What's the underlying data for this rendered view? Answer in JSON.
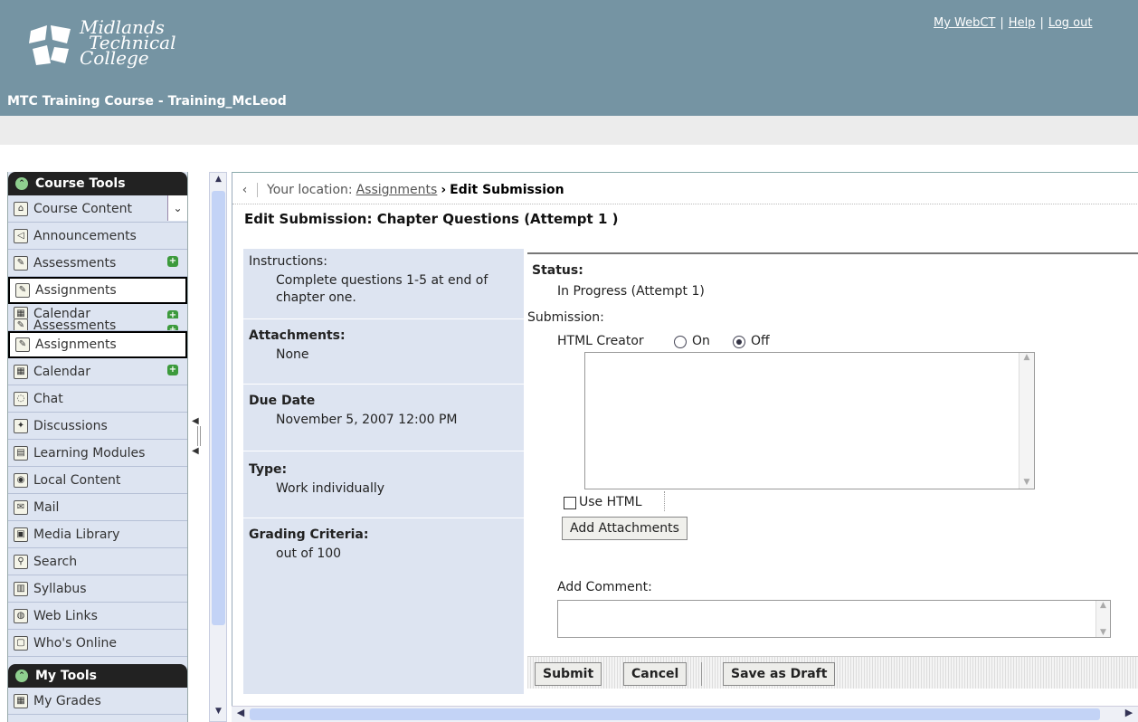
{
  "header": {
    "logo_line1": "Midlands",
    "logo_line2": "Technical",
    "logo_line3": "College",
    "course_title": "MTC Training Course - Training_McLeod",
    "links": {
      "my_webct": "My WebCT",
      "help": "Help",
      "logout": "Log out",
      "separator": "|"
    }
  },
  "sidebar": {
    "course_tools_label": "Course Tools",
    "my_tools_label": "My Tools",
    "items": [
      {
        "label": "Course Content",
        "icon": "home-icon"
      },
      {
        "label": "Announcements",
        "icon": "megaphone-icon"
      },
      {
        "label": "Assessments",
        "icon": "assessment-icon"
      },
      {
        "label": "Assignments",
        "icon": "assignment-icon"
      },
      {
        "label": "Calendar",
        "icon": "calendar-icon"
      },
      {
        "label": "Assessments",
        "icon": "assessment-icon"
      },
      {
        "label": "Assignments",
        "icon": "assignment-icon"
      },
      {
        "label": "Calendar",
        "icon": "calendar-icon"
      },
      {
        "label": "Chat",
        "icon": "chat-icon"
      },
      {
        "label": "Discussions",
        "icon": "pin-icon"
      },
      {
        "label": "Learning Modules",
        "icon": "module-icon"
      },
      {
        "label": "Local Content",
        "icon": "disc-icon"
      },
      {
        "label": "Mail",
        "icon": "mail-icon"
      },
      {
        "label": "Media Library",
        "icon": "media-icon"
      },
      {
        "label": "Search",
        "icon": "magnifier-icon"
      },
      {
        "label": "Syllabus",
        "icon": "syllabus-icon"
      },
      {
        "label": "Web Links",
        "icon": "web-icon"
      },
      {
        "label": "Who's Online",
        "icon": "online-icon"
      }
    ],
    "my_tools_items": [
      {
        "label": "My Grades",
        "icon": "grades-icon"
      }
    ]
  },
  "breadcrumb": {
    "prefix": "Your location:",
    "link": "Assignments",
    "arrow": "›",
    "current": "Edit Submission"
  },
  "page": {
    "title": "Edit Submission: Chapter Questions (Attempt 1 )"
  },
  "info": {
    "instructions_label": "Instructions:",
    "instructions_value": "Complete questions 1-5 at end of chapter one.",
    "attachments_label": "Attachments:",
    "attachments_value": "None",
    "due_label": "Due Date",
    "due_value": "November 5, 2007 12:00 PM",
    "type_label": "Type:",
    "type_value": "Work individually",
    "grading_label": "Grading Criteria:",
    "grading_value": "out of 100"
  },
  "form": {
    "status_label": "Status:",
    "status_value": "In Progress (Attempt 1)",
    "submission_label": "Submission:",
    "html_creator_label": "HTML Creator",
    "on_label": "On",
    "off_label": "Off",
    "html_creator_selected": "Off",
    "use_html_label": "Use HTML",
    "use_html_checked": false,
    "add_attachments_label": "Add Attachments",
    "add_comment_label": "Add Comment:",
    "submission_text": "",
    "comment_text": ""
  },
  "buttons": {
    "submit": "Submit",
    "cancel": "Cancel",
    "save_draft": "Save as Draft"
  },
  "colors": {
    "header_bg": "#7594a3",
    "sidebar_bg": "#dde4f1",
    "section_head_bg": "#222222",
    "accent_green": "#3c9a3c"
  }
}
